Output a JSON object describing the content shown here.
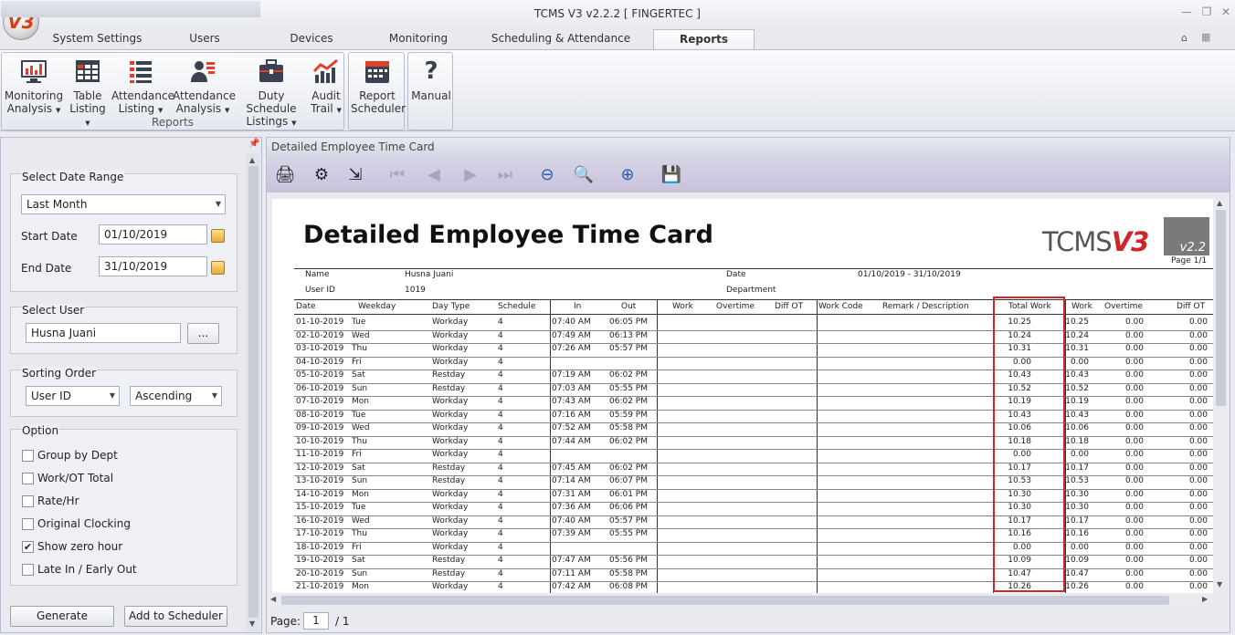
{
  "app": {
    "title": "TCMS V3 v2.2.2 [ FINGERTEC ]",
    "logo_text": "V3"
  },
  "tabs": [
    {
      "label": "System Settings"
    },
    {
      "label": "Users"
    },
    {
      "label": "Devices"
    },
    {
      "label": "Monitoring"
    },
    {
      "label": "Scheduling & Attendance"
    },
    {
      "label": "Reports"
    }
  ],
  "ribbon": {
    "group1": {
      "label": "Reports",
      "buttons": [
        {
          "label": "Monitoring\nAnalysis",
          "icon": "monitor-chart-icon"
        },
        {
          "label": "Table\nListing",
          "icon": "table-icon"
        },
        {
          "label": "Attendance\nListing",
          "icon": "list-icon"
        },
        {
          "label": "Attendance\nAnalysis",
          "icon": "user-list-icon"
        },
        {
          "label": "Duty Schedule\nListings",
          "icon": "briefcase-icon"
        },
        {
          "label": "Audit\nTrail",
          "icon": "line-chart-icon"
        }
      ]
    },
    "group2": {
      "label": "Report\nScheduler",
      "icon": "calendar-icon"
    },
    "group3": {
      "label": "Manual",
      "icon": "question-icon"
    }
  },
  "left": {
    "date_range": {
      "title": "Select Date Range",
      "preset": "Last Month",
      "start_label": "Start Date",
      "start": "01/10/2019",
      "end_label": "End Date",
      "end": "31/10/2019"
    },
    "user": {
      "title": "Select User",
      "value": "Husna Juani",
      "browse": "..."
    },
    "sorting": {
      "title": "Sorting Order",
      "field": "User ID",
      "order": "Ascending"
    },
    "option": {
      "title": "Option",
      "items": [
        {
          "label": "Group by Dept",
          "checked": false
        },
        {
          "label": "Work/OT Total",
          "checked": false
        },
        {
          "label": "Rate/Hr",
          "checked": false
        },
        {
          "label": "Original Clocking",
          "checked": false
        },
        {
          "label": "Show zero hour",
          "checked": true
        },
        {
          "label": "Late In / Early Out",
          "checked": false
        }
      ]
    },
    "generate": "Generate",
    "scheduler": "Add to Scheduler"
  },
  "viewer": {
    "title": "Detailed Employee Time Card",
    "page_label": "Page:",
    "page": "1",
    "page_total": "/ 1"
  },
  "report": {
    "title": "Detailed Employee Time Card",
    "logo": "TCMS",
    "logo_v": "V3",
    "logo_ver": "v2.2",
    "page": "Page 1/1",
    "name_label": "Name",
    "name": "Husna Juani",
    "userid_label": "User ID",
    "userid": "1019",
    "date_label": "Date",
    "date": "01/10/2019 - 31/10/2019",
    "dept_label": "Department",
    "columns": [
      "Date",
      "Weekday",
      "Day Type",
      "Schedule",
      "In",
      "Out",
      "Work",
      "Overtime",
      "Diff OT",
      "Work Code",
      "Remark / Description",
      "Total Work",
      "Work",
      "Overtime",
      "Diff OT"
    ],
    "rows": [
      [
        "01-10-2019",
        "Tue",
        "Workday",
        "4",
        "07:40 AM",
        "06:05 PM",
        "10.25",
        "10.25",
        "0.00",
        "0.00"
      ],
      [
        "02-10-2019",
        "Wed",
        "Workday",
        "4",
        "07:49 AM",
        "06:13 PM",
        "10.24",
        "10.24",
        "0.00",
        "0.00"
      ],
      [
        "03-10-2019",
        "Thu",
        "Workday",
        "4",
        "07:26 AM",
        "05:57 PM",
        "10.31",
        "10.31",
        "0.00",
        "0.00"
      ],
      [
        "04-10-2019",
        "Fri",
        "Workday",
        "4",
        "",
        "",
        "0.00",
        "0.00",
        "0.00",
        "0.00"
      ],
      [
        "05-10-2019",
        "Sat",
        "Restday",
        "4",
        "07:19 AM",
        "06:02 PM",
        "10.43",
        "10.43",
        "0.00",
        "0.00"
      ],
      [
        "06-10-2019",
        "Sun",
        "Restday",
        "4",
        "07:03 AM",
        "05:55 PM",
        "10.52",
        "10.52",
        "0.00",
        "0.00"
      ],
      [
        "07-10-2019",
        "Mon",
        "Workday",
        "4",
        "07:43 AM",
        "06:02 PM",
        "10.19",
        "10.19",
        "0.00",
        "0.00"
      ],
      [
        "08-10-2019",
        "Tue",
        "Workday",
        "4",
        "07:16 AM",
        "05:59 PM",
        "10.43",
        "10.43",
        "0.00",
        "0.00"
      ],
      [
        "09-10-2019",
        "Wed",
        "Workday",
        "4",
        "07:52 AM",
        "05:58 PM",
        "10.06",
        "10.06",
        "0.00",
        "0.00"
      ],
      [
        "10-10-2019",
        "Thu",
        "Workday",
        "4",
        "07:44 AM",
        "06:02 PM",
        "10.18",
        "10.18",
        "0.00",
        "0.00"
      ],
      [
        "11-10-2019",
        "Fri",
        "Workday",
        "4",
        "",
        "",
        "0.00",
        "0.00",
        "0.00",
        "0.00"
      ],
      [
        "12-10-2019",
        "Sat",
        "Restday",
        "4",
        "07:45 AM",
        "06:02 PM",
        "10.17",
        "10.17",
        "0.00",
        "0.00"
      ],
      [
        "13-10-2019",
        "Sun",
        "Restday",
        "4",
        "07:14 AM",
        "06:07 PM",
        "10.53",
        "10.53",
        "0.00",
        "0.00"
      ],
      [
        "14-10-2019",
        "Mon",
        "Workday",
        "4",
        "07:31 AM",
        "06:01 PM",
        "10.30",
        "10.30",
        "0.00",
        "0.00"
      ],
      [
        "15-10-2019",
        "Tue",
        "Workday",
        "4",
        "07:36 AM",
        "06:06 PM",
        "10.30",
        "10.30",
        "0.00",
        "0.00"
      ],
      [
        "16-10-2019",
        "Wed",
        "Workday",
        "4",
        "07:40 AM",
        "05:57 PM",
        "10.17",
        "10.17",
        "0.00",
        "0.00"
      ],
      [
        "17-10-2019",
        "Thu",
        "Workday",
        "4",
        "07:39 AM",
        "05:55 PM",
        "10.16",
        "10.16",
        "0.00",
        "0.00"
      ],
      [
        "18-10-2019",
        "Fri",
        "Workday",
        "4",
        "",
        "",
        "0.00",
        "0.00",
        "0.00",
        "0.00"
      ],
      [
        "19-10-2019",
        "Sat",
        "Restday",
        "4",
        "07:47 AM",
        "05:56 PM",
        "10.09",
        "10.09",
        "0.00",
        "0.00"
      ],
      [
        "20-10-2019",
        "Sun",
        "Restday",
        "4",
        "07:11 AM",
        "05:58 PM",
        "10.47",
        "10.47",
        "0.00",
        "0.00"
      ],
      [
        "21-10-2019",
        "Mon",
        "Workday",
        "4",
        "07:42 AM",
        "06:08 PM",
        "10.26",
        "10.26",
        "0.00",
        "0.00"
      ]
    ]
  },
  "colors": {
    "accent": "#d0262a",
    "ribbon": "#e3e6ee",
    "toolbar": "#c8c2dc"
  }
}
